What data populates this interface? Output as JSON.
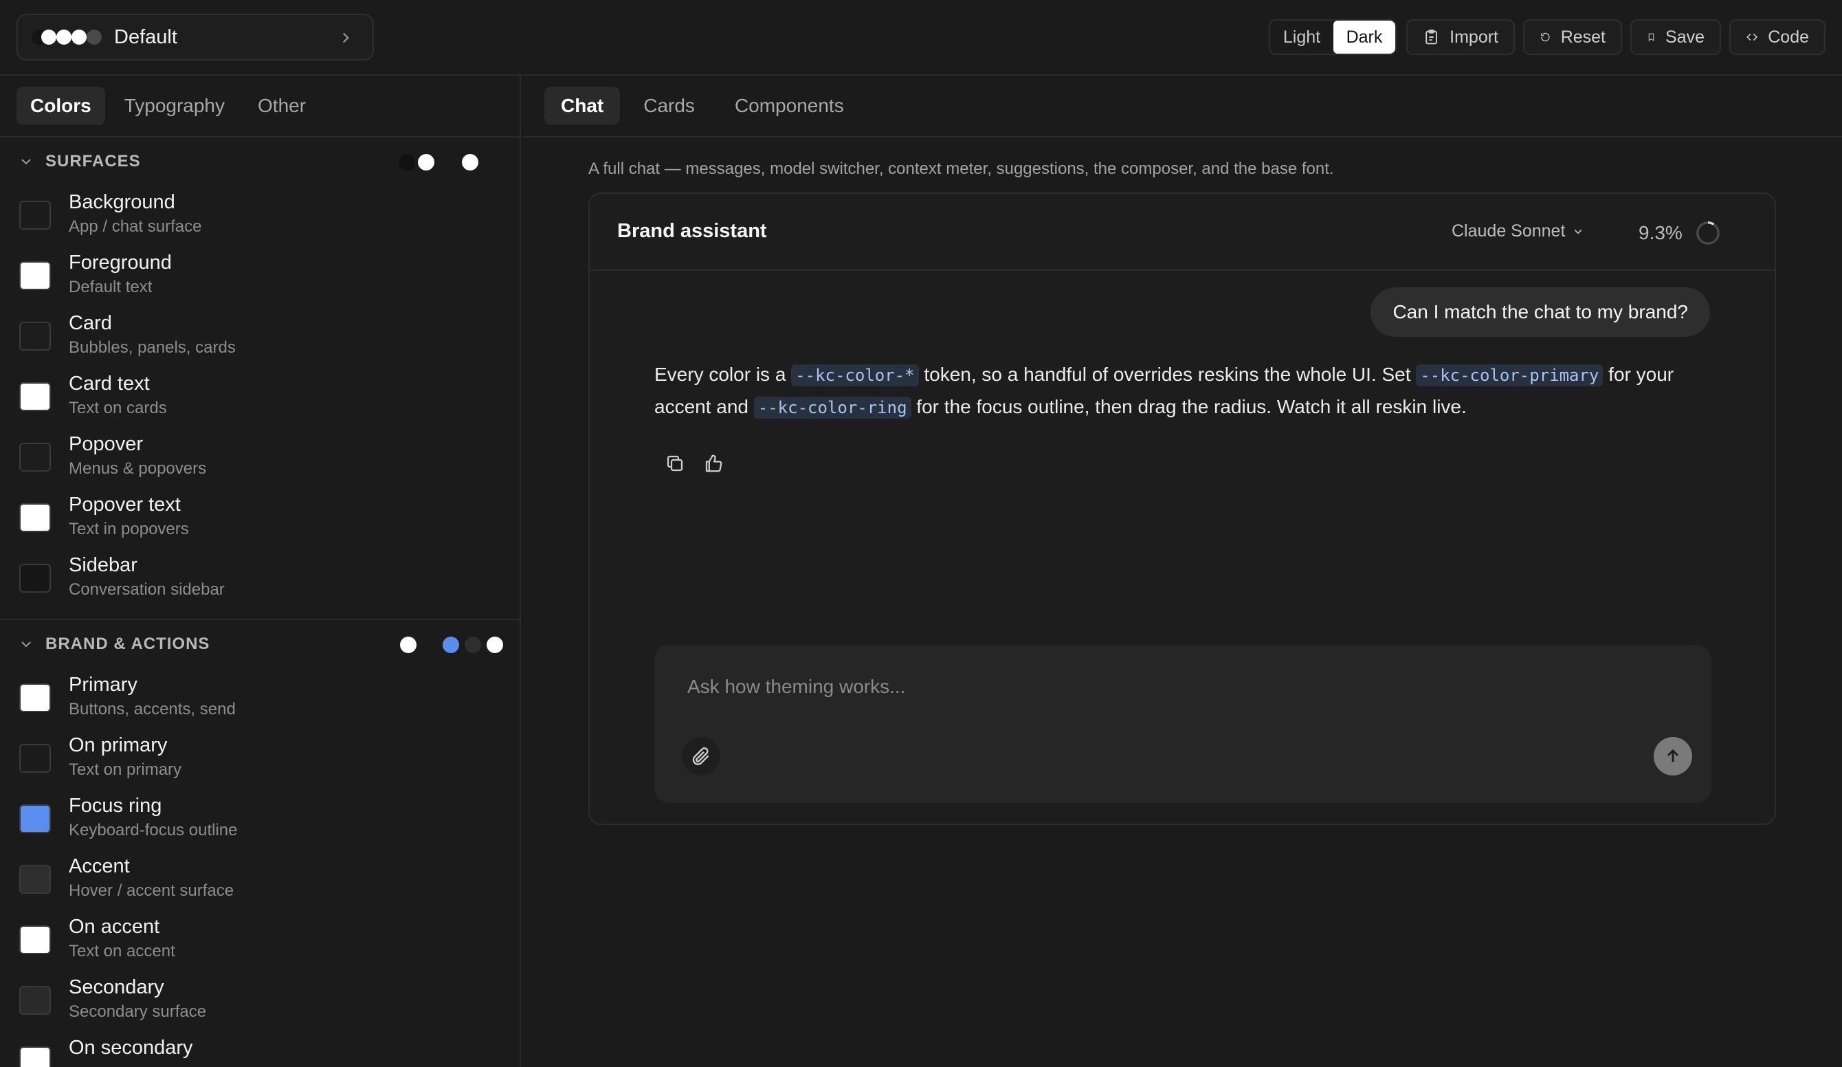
{
  "topbar": {
    "theme_name": "Default",
    "theme_dots": [
      "#1b1b1b",
      "#ffffff",
      "#ffffff",
      "#ffffff",
      "#4a4a4a"
    ],
    "mode_light": "Light",
    "mode_dark": "Dark",
    "active_mode": "Dark",
    "import_label": "Import",
    "reset_label": "Reset",
    "save_label": "Save",
    "code_label": "Code"
  },
  "left": {
    "tabs": [
      "Colors",
      "Typography",
      "Other"
    ],
    "active_tab": "Colors",
    "surfaces": {
      "title": "SURFACES",
      "dots": [
        "#111111",
        "#ffffff",
        "#ffffff"
      ],
      "tokens": [
        {
          "name": "Background",
          "desc": "App / chat surface",
          "color": "#1b1b1b"
        },
        {
          "name": "Foreground",
          "desc": "Default text",
          "color": "#ffffff"
        },
        {
          "name": "Card",
          "desc": "Bubbles, panels, cards",
          "color": "#1d1d1d"
        },
        {
          "name": "Card text",
          "desc": "Text on cards",
          "color": "#ffffff"
        },
        {
          "name": "Popover",
          "desc": "Menus & popovers",
          "color": "#1d1d1d"
        },
        {
          "name": "Popover text",
          "desc": "Text in popovers",
          "color": "#ffffff"
        },
        {
          "name": "Sidebar",
          "desc": "Conversation sidebar",
          "color": "#161616"
        }
      ]
    },
    "brand": {
      "title": "BRAND & ACTIONS",
      "dots": [
        "#ffffff",
        "#5b8def",
        "#2e2e2e",
        "#ffffff"
      ],
      "tokens": [
        {
          "name": "Primary",
          "desc": "Buttons, accents, send",
          "color": "#ffffff"
        },
        {
          "name": "On primary",
          "desc": "Text on primary",
          "color": "#1b1b1b"
        },
        {
          "name": "Focus ring",
          "desc": "Keyboard-focus outline",
          "color": "#5b8def"
        },
        {
          "name": "Accent",
          "desc": "Hover / accent surface",
          "color": "#2e2e2e"
        },
        {
          "name": "On accent",
          "desc": "Text on accent",
          "color": "#ffffff"
        },
        {
          "name": "Secondary",
          "desc": "Secondary surface",
          "color": "#2a2a2a"
        },
        {
          "name": "On secondary",
          "desc": "",
          "color": "#ffffff"
        }
      ]
    }
  },
  "right": {
    "tabs": [
      "Chat",
      "Cards",
      "Components"
    ],
    "active_tab": "Chat",
    "description": "A full chat — messages, model switcher, context meter, suggestions, the composer, and the base font.",
    "chat": {
      "title": "Brand assistant",
      "model": "Claude Sonnet",
      "context_usage": "9.3%",
      "context_fraction": 0.093,
      "user_message": "Can I match the chat to my brand?",
      "assistant_parts": [
        "Every color is a ",
        "--kc-color-*",
        " token, so a handful of overrides reskins the whole UI. Set ",
        "--kc-color-primary",
        " for your accent and ",
        "--kc-color-ring",
        " for the focus outline, then drag the radius. Watch it all reskin live."
      ],
      "composer_placeholder": "Ask how theming works..."
    }
  }
}
